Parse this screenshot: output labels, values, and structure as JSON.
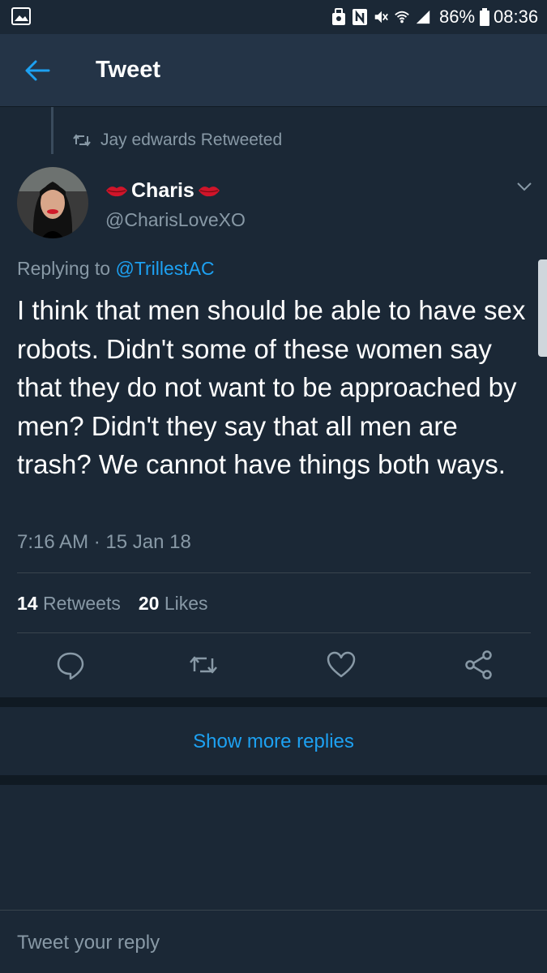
{
  "status_bar": {
    "battery": "86%",
    "time": "08:36",
    "icons": [
      "gallery-icon",
      "recycle-icon",
      "nfc-icon",
      "mute-icon",
      "wifi-icon",
      "signal-icon",
      "battery-icon"
    ]
  },
  "header": {
    "title": "Tweet",
    "back_icon": "back-arrow-icon"
  },
  "tweet": {
    "retweeted_by": "Jay edwards Retweeted",
    "author": {
      "name": "Charis",
      "handle": "@CharisLoveXO",
      "name_decoration": "lips-icon"
    },
    "replying_prefix": "Replying to ",
    "replying_to": "@TrillestAC",
    "text": "I think that men should be able to have sex robots. Didn't some of these women say that they do not want to be approached by men? Didn't they say that all men are trash? We cannot have things both ways.",
    "timestamp": "7:16 AM · 15 Jan 18",
    "stats": {
      "retweets_count": "14",
      "retweets_label": "Retweets",
      "likes_count": "20",
      "likes_label": "Likes"
    },
    "actions": [
      "reply-icon",
      "retweet-icon",
      "like-icon",
      "share-icon"
    ]
  },
  "show_more": "Show more replies",
  "reply": {
    "placeholder": "Tweet your reply"
  },
  "colors": {
    "background": "#1b2836",
    "header": "#243447",
    "accent": "#1da1f2",
    "muted": "#8899a6"
  }
}
